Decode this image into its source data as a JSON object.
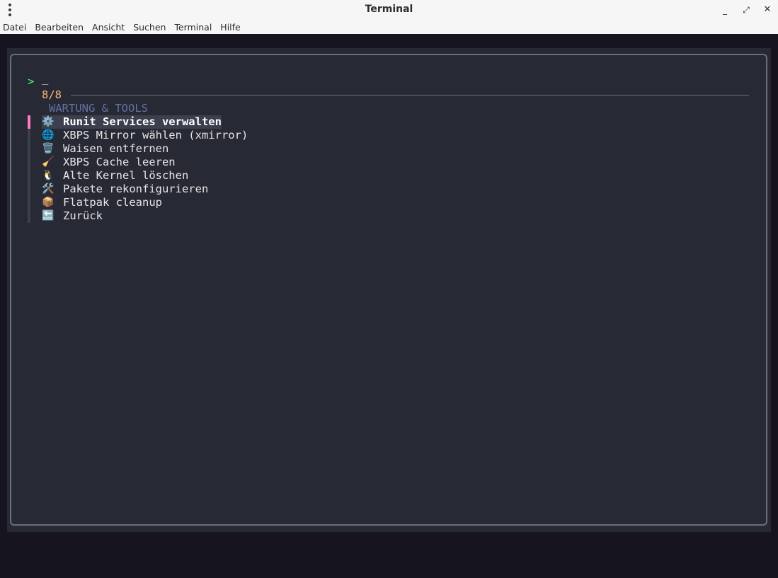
{
  "window": {
    "title": "Terminal",
    "minimize_glyph": "_",
    "maximize_glyph": "⤢",
    "close_glyph": "✕"
  },
  "menubar": {
    "items": [
      "Datei",
      "Bearbeiten",
      "Ansicht",
      "Suchen",
      "Terminal",
      "Hilfe"
    ]
  },
  "terminal": {
    "prompt": ">",
    "cursor": "_",
    "count": "8/8",
    "header": "WARTUNG & TOOLS",
    "items": [
      {
        "icon": "gear-icon",
        "glyph": "⚙️",
        "label": "Runit Services verwalten",
        "selected": true
      },
      {
        "icon": "globe-icon",
        "glyph": "🌐",
        "label": "XBPS Mirror wählen (xmirror)",
        "selected": false
      },
      {
        "icon": "trash-icon",
        "glyph": "🗑️",
        "label": "Waisen entfernen",
        "selected": false
      },
      {
        "icon": "broom-icon",
        "glyph": "🧹",
        "label": "XBPS Cache leeren",
        "selected": false
      },
      {
        "icon": "penguin-icon",
        "glyph": "🐧",
        "label": "Alte Kernel löschen",
        "selected": false
      },
      {
        "icon": "tools-icon",
        "glyph": "🛠️",
        "label": "Pakete rekonfigurieren",
        "selected": false
      },
      {
        "icon": "package-icon",
        "glyph": "📦",
        "label": "Flatpak cleanup",
        "selected": false
      },
      {
        "icon": "back-arrow-icon",
        "glyph": "🔙",
        "label": "Zurück",
        "selected": false
      }
    ]
  },
  "colors": {
    "terminal_bg": "#272935",
    "outer_bg": "#16151f",
    "prompt": "#50fa7b",
    "count": "#ffb86c",
    "header": "#6272a4",
    "selection_bar": "#ff79c6"
  }
}
